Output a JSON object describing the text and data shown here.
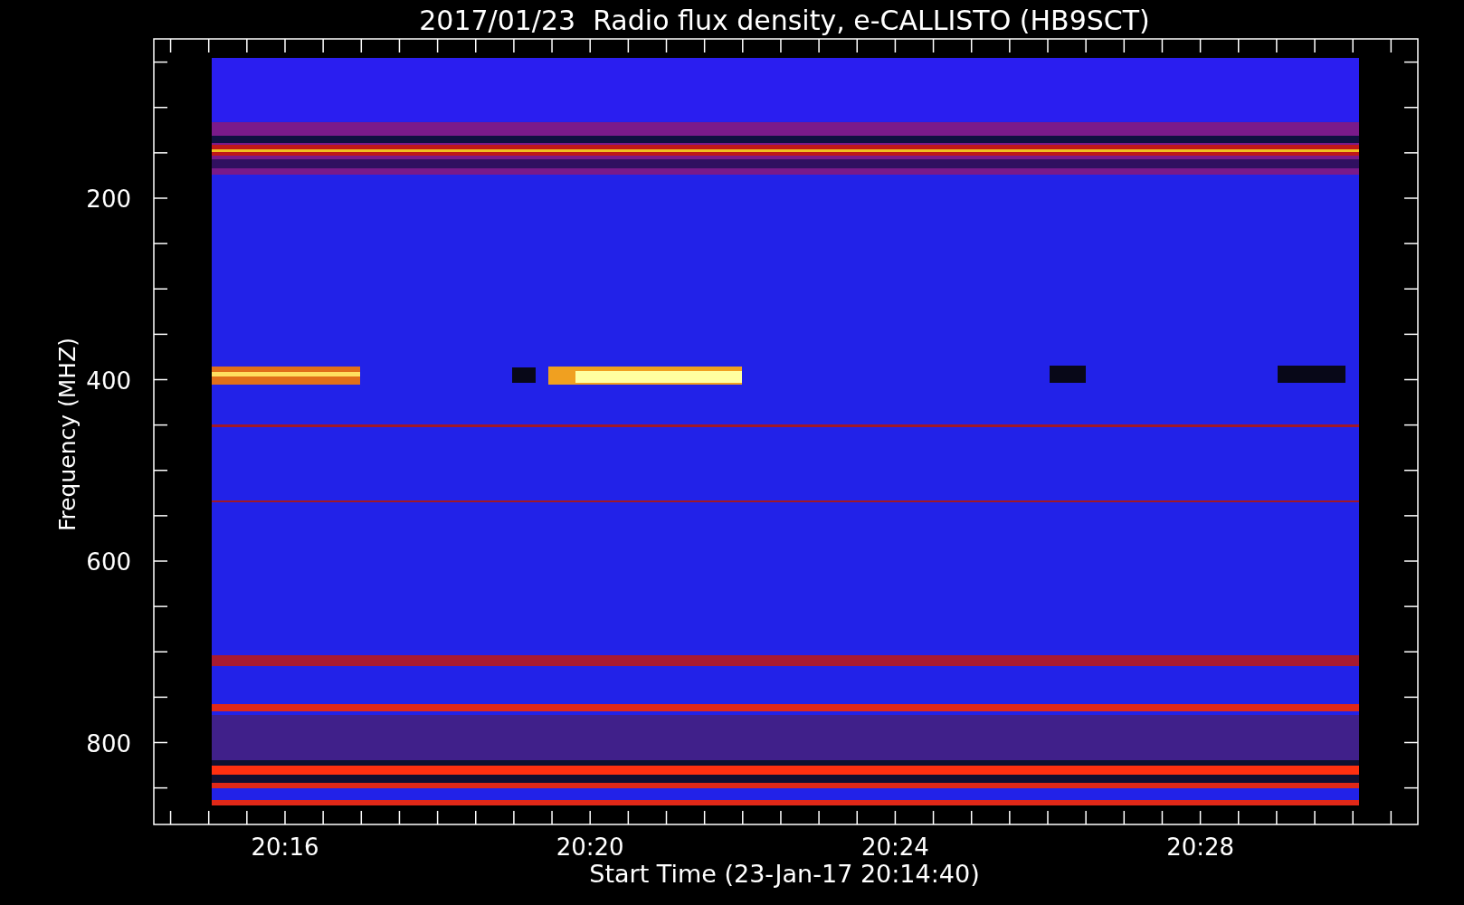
{
  "title": "2017/01/23  Radio flux density, e-CALLISTO (HB9SCT)",
  "y_axis": {
    "label": "Frequency (MHZ)",
    "ticks": [
      "200",
      "400",
      "600",
      "800"
    ]
  },
  "x_axis": {
    "label": "Start Time (23-Jan-17 20:14:40)",
    "ticks": [
      "20:16",
      "20:20",
      "20:24",
      "20:28"
    ]
  }
}
